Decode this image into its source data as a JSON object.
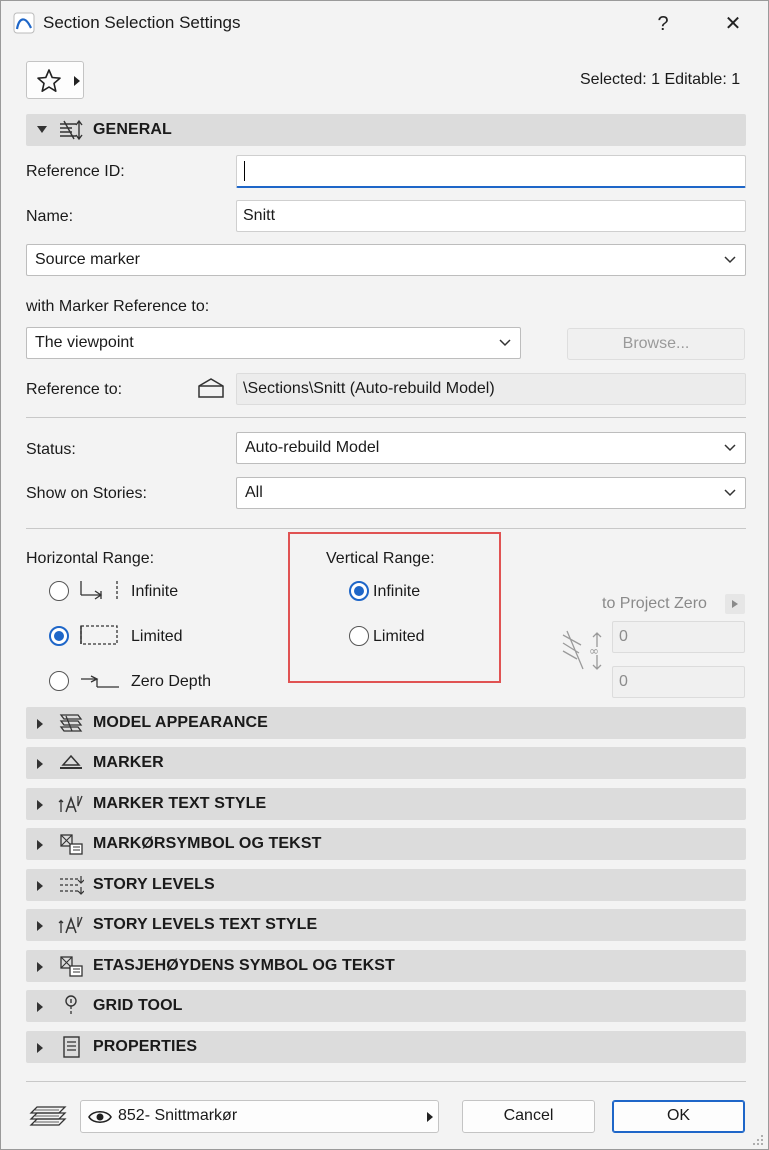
{
  "window": {
    "title": "Section Selection Settings",
    "help": "?",
    "close": "✕"
  },
  "favorites": {
    "icon": "star-icon"
  },
  "selection_info": "Selected: 1 Editable: 1",
  "general": {
    "header": "GENERAL",
    "reference_id_label": "Reference ID:",
    "reference_id_value": "",
    "name_label": "Name:",
    "name_value": "Snitt",
    "source_select": "Source marker",
    "marker_ref_label": "with Marker Reference to:",
    "marker_ref_select": "The viewpoint",
    "browse_button": "Browse...",
    "reference_to_label": "Reference to:",
    "reference_to_value": "\\Sections\\Snitt (Auto-rebuild Model)",
    "status_label": "Status:",
    "status_select": "Auto-rebuild Model",
    "show_on_stories_label": "Show on Stories:",
    "show_on_stories_select": "All",
    "horizontal_range": {
      "label": "Horizontal Range:",
      "options": [
        {
          "label": "Infinite",
          "selected": false
        },
        {
          "label": "Limited",
          "selected": true
        },
        {
          "label": "Zero Depth",
          "selected": false
        }
      ]
    },
    "vertical_range": {
      "label": "Vertical Range:",
      "options": [
        {
          "label": "Infinite",
          "selected": true
        },
        {
          "label": "Limited",
          "selected": false
        }
      ]
    },
    "to_project_zero": "to Project Zero",
    "top_value": "0",
    "bottom_value": "0"
  },
  "panels": [
    {
      "label": "MODEL APPEARANCE",
      "icon": "model-appearance-icon"
    },
    {
      "label": "MARKER",
      "icon": "marker-icon"
    },
    {
      "label": "MARKER TEXT STYLE",
      "icon": "text-style-icon"
    },
    {
      "label": "MARKØRSYMBOL OG TEKST",
      "icon": "symbol-text-icon"
    },
    {
      "label": "STORY LEVELS",
      "icon": "story-levels-icon"
    },
    {
      "label": "STORY LEVELS TEXT STYLE",
      "icon": "text-style-icon"
    },
    {
      "label": "ETASJEHØYDENS SYMBOL OG TEKST",
      "icon": "symbol-text-icon"
    },
    {
      "label": "GRID TOOL",
      "icon": "grid-tool-icon"
    },
    {
      "label": "PROPERTIES",
      "icon": "properties-icon"
    }
  ],
  "footer": {
    "layer_select": "852- Snittmarkør",
    "cancel": "Cancel",
    "ok": "OK"
  },
  "colors": {
    "accent": "#1e66c8",
    "highlight": "#e05252",
    "panel": "#dcdcdc"
  }
}
